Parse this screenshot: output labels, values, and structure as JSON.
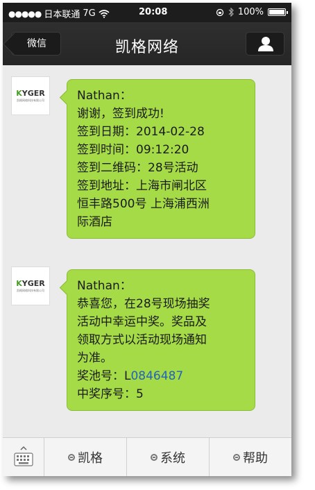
{
  "status_bar": {
    "signal": "●●●●●",
    "carrier": "日本联通",
    "network": "7G",
    "time": "20:08",
    "battery": "100%",
    "battery_level": 1.0
  },
  "nav": {
    "back_label": "微信",
    "title": "凯格网络"
  },
  "avatar": {
    "logo_k": "K",
    "logo_rest": "YGER",
    "tagline": "凯格网络科技有限公司"
  },
  "messages": [
    {
      "lines": [
        "Nathan：",
        "谢谢，签到成功!",
        "签到日期：2014-02-28",
        "签到时间：09:12:20",
        "签到二维码：28号活动",
        "签到地址：上海市闸北区",
        "恒丰路500号 上海浦西洲",
        "际酒店"
      ]
    },
    {
      "lines": [
        "Nathan：",
        "恭喜您，在28号现场抽奖",
        "活动中幸运中奖。奖品及",
        "领取方式以活动现场通知",
        "为准。"
      ],
      "pool_label": "奖池号：L",
      "pool_link": "0846487",
      "seq": "中奖序号：5"
    }
  ],
  "bottom_menu": [
    "凯格",
    "系统",
    "帮助"
  ],
  "colors": {
    "bubble": "#a5db46",
    "link": "#2264b6",
    "navbar": "#262626"
  }
}
